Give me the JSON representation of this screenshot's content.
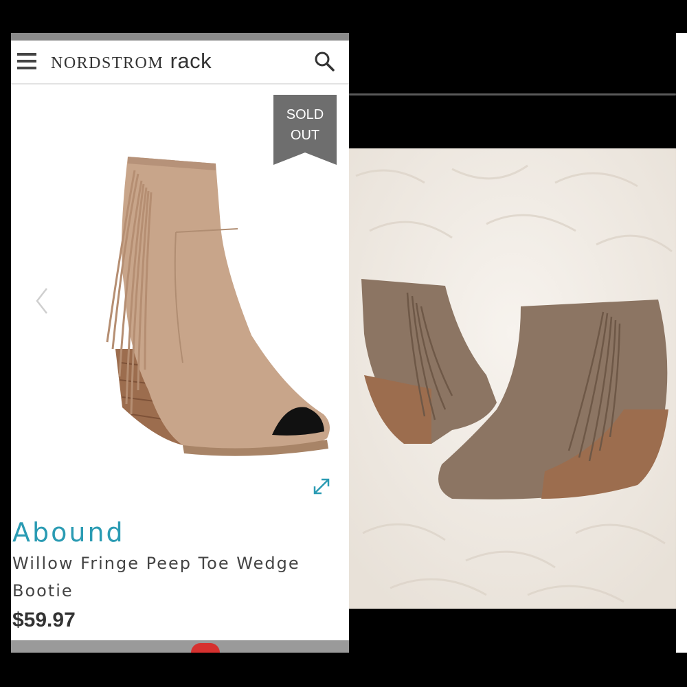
{
  "header": {
    "brand_primary": "NORDSTROM",
    "brand_secondary": "rack"
  },
  "badge": {
    "line1": "SOLD",
    "line2": "OUT"
  },
  "product": {
    "brand": "Abound",
    "title_line1": "Willow Fringe Peep Toe Wedge",
    "title_line2": "Bootie",
    "price": "$59.97"
  },
  "icons": {
    "menu": "hamburger-menu-icon",
    "search": "search-icon",
    "prev": "chevron-left-icon",
    "expand": "expand-arrows-icon"
  },
  "colors": {
    "brand_accent": "#2a9bb3",
    "badge_bg": "#6e6e6e",
    "boot_suede": "#c8a58a",
    "photo_boot": "#8c7563",
    "wood": "#9c6d4e",
    "fur": "#f2ede6"
  }
}
